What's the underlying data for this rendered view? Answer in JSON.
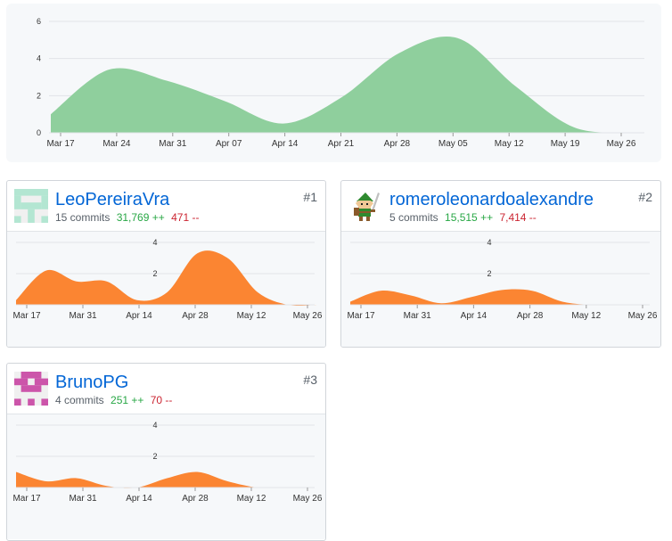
{
  "colors": {
    "main_fill": "#8fcf9d",
    "contrib_fill": "#fb8532",
    "grid": "#e1e4e8",
    "text": "#586069",
    "link": "#0366d6",
    "add": "#28a745",
    "del": "#cb2431"
  },
  "main_chart": {
    "chart_data": {
      "type": "area",
      "x_ticks": [
        "Mar 17",
        "Mar 24",
        "Mar 31",
        "Apr 07",
        "Apr 14",
        "Apr 21",
        "Apr 28",
        "May 05",
        "May 12",
        "May 19",
        "May 26"
      ],
      "y_ticks": [
        "0",
        "2",
        "4",
        "6"
      ],
      "ylim": [
        0,
        6
      ],
      "values": [
        1,
        3.4,
        2.8,
        1.7,
        0.5,
        1.9,
        4.3,
        5.1,
        2.5,
        0.3,
        0
      ],
      "grid": true
    }
  },
  "contributors": [
    {
      "rank": "#1",
      "name": "LeoPereiraVra",
      "commits": "15 commits",
      "additions": "31,769 ++",
      "deletions": "471 --",
      "avatar": "identicon-teal",
      "chart_data": {
        "type": "area",
        "x_ticks": [
          "Mar 17",
          "Mar 31",
          "Apr 14",
          "Apr 28",
          "May 12",
          "May 26"
        ],
        "y_ticks": [
          "2",
          "4"
        ],
        "ylim": [
          0,
          4
        ],
        "values": [
          0.3,
          2.2,
          1.5,
          1.5,
          0.3,
          0.8,
          3.3,
          3.0,
          0.8,
          0,
          0
        ]
      }
    },
    {
      "rank": "#2",
      "name": "romeroleonardoalexandre",
      "commits": "5 commits",
      "additions": "15,515 ++",
      "deletions": "7,414 --",
      "avatar": "link-sprite",
      "chart_data": {
        "type": "area",
        "x_ticks": [
          "Mar 17",
          "Mar 31",
          "Apr 14",
          "Apr 28",
          "May 12",
          "May 26"
        ],
        "y_ticks": [
          "2",
          "4"
        ],
        "ylim": [
          0,
          4
        ],
        "values": [
          0.2,
          0.9,
          0.6,
          0.1,
          0.5,
          0.95,
          0.9,
          0.2,
          0,
          0,
          0
        ]
      }
    },
    {
      "rank": "#3",
      "name": "BrunoPG",
      "commits": "4 commits",
      "additions": "251 ++",
      "deletions": "70 --",
      "avatar": "identicon-magenta",
      "chart_data": {
        "type": "area",
        "x_ticks": [
          "Mar 17",
          "Mar 31",
          "Apr 14",
          "Apr 28",
          "May 12",
          "May 26"
        ],
        "y_ticks": [
          "2",
          "4"
        ],
        "ylim": [
          0,
          4
        ],
        "values": [
          1.0,
          0.4,
          0.6,
          0.1,
          0,
          0.6,
          1.0,
          0.4,
          0,
          0,
          0
        ]
      }
    }
  ]
}
